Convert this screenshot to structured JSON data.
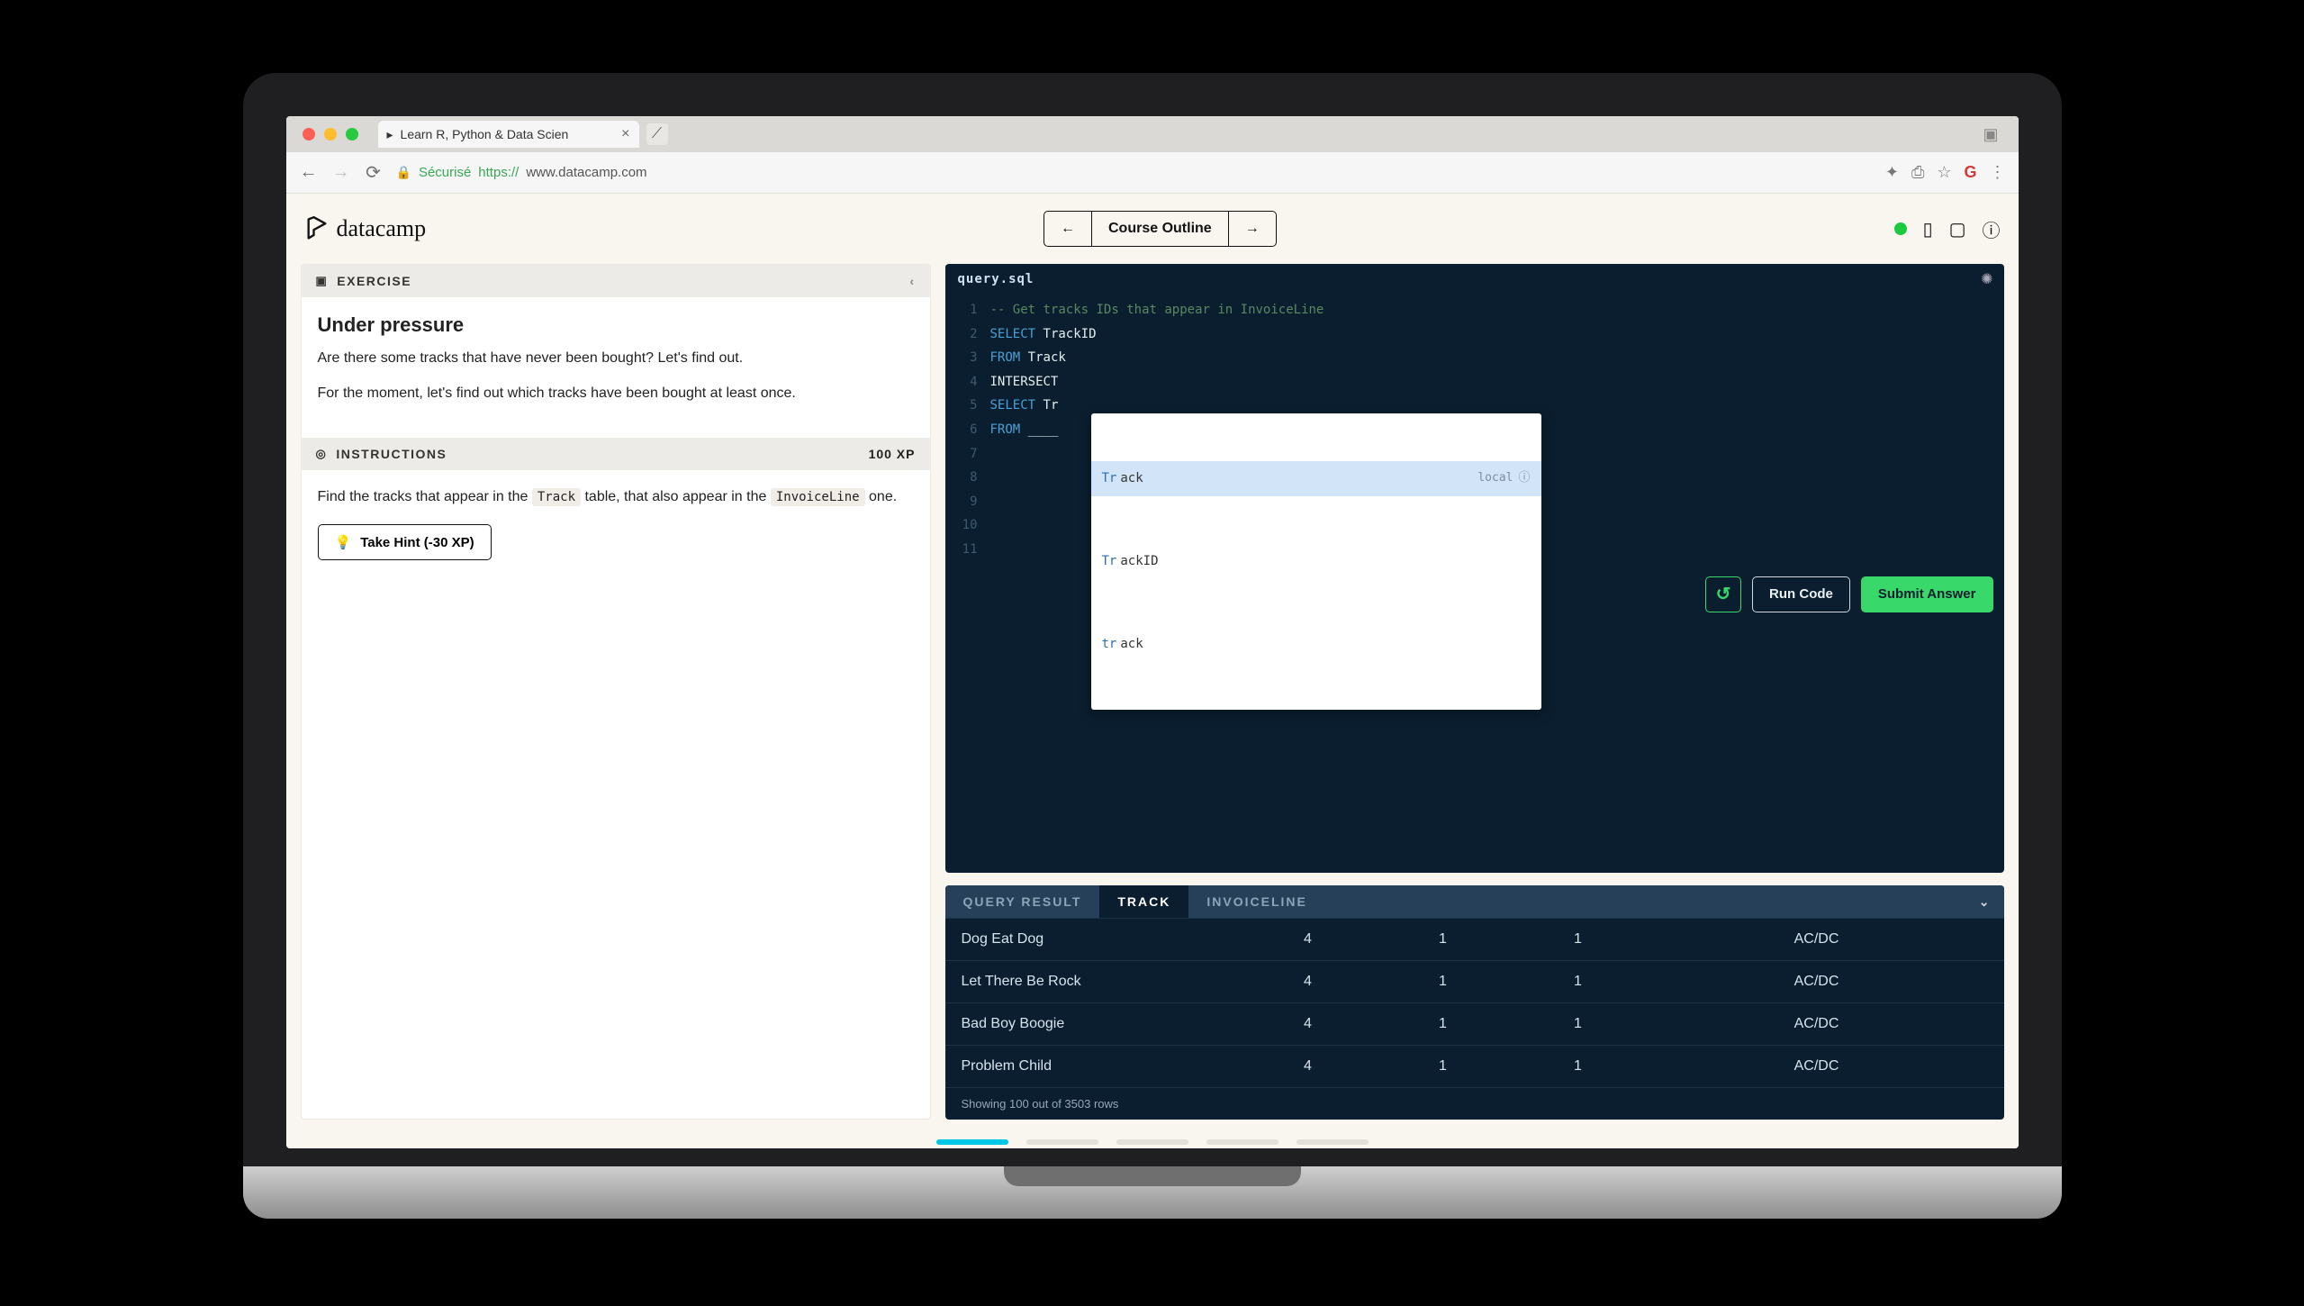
{
  "browser": {
    "tab_title": "Learn R, Python & Data Scien",
    "secure_label": "Sécurisé",
    "url_prefix": "https://",
    "url": "www.datacamp.com"
  },
  "header": {
    "brand": "datacamp",
    "course_outline_label": "Course Outline"
  },
  "exercise": {
    "section_label": "EXERCISE",
    "title": "Under pressure",
    "p1": "Are there some tracks that have never been bought? Let's find out.",
    "p2": "For the moment, let's find out which tracks have been bought at least once."
  },
  "instructions": {
    "section_label": "INSTRUCTIONS",
    "xp_label": "100 XP",
    "text_a": "Find the tracks that appear in the ",
    "code_a": "Track",
    "text_b": " table, that also appear in the ",
    "code_b": "InvoiceLine",
    "text_c": " one.",
    "hint_label": "Take Hint (-30 XP)"
  },
  "editor": {
    "tab_label": "query.sql",
    "lines": [
      "1",
      "2",
      "3",
      "4",
      "5",
      "6",
      "7",
      "8",
      "9",
      "10",
      "11"
    ],
    "code": {
      "l1_comment": "-- Get tracks IDs that appear in InvoiceLine",
      "l2_kw": "SELECT",
      "l2_id": "TrackID",
      "l3_kw": "FROM",
      "l3_id": "Track",
      "l4_id": "INTERSECT",
      "l5_kw": "SELECT",
      "l5_id": "Tr",
      "l6_kw": "FROM",
      "l6_id": "____"
    },
    "autocomplete": {
      "items": [
        {
          "match": "Tr",
          "rest": "ack"
        },
        {
          "match": "Tr",
          "rest": "ackID"
        },
        {
          "match": "tr",
          "rest": "ack"
        }
      ],
      "meta_label": "local"
    },
    "actions": {
      "run": "Run Code",
      "submit": "Submit Answer"
    }
  },
  "results": {
    "tabs": {
      "label": "query result",
      "track": "TRACK",
      "invoiceline": "INVOICELINE"
    },
    "rows": [
      {
        "c1": "Dog Eat Dog",
        "c2": "4",
        "c3": "1",
        "c4": "1",
        "c5": "AC/DC"
      },
      {
        "c1": "Let There Be Rock",
        "c2": "4",
        "c3": "1",
        "c4": "1",
        "c5": "AC/DC"
      },
      {
        "c1": "Bad Boy Boogie",
        "c2": "4",
        "c3": "1",
        "c4": "1",
        "c5": "AC/DC"
      },
      {
        "c1": "Problem Child",
        "c2": "4",
        "c3": "1",
        "c4": "1",
        "c5": "AC/DC"
      }
    ],
    "footer": "Showing 100 out of 3503 rows"
  },
  "chart_data": {
    "type": "table",
    "title": "TRACK",
    "rows": [
      {
        "Name": "Dog Eat Dog",
        "A": 4,
        "B": 1,
        "C": 1,
        "Artist": "AC/DC"
      },
      {
        "Name": "Let There Be Rock",
        "A": 4,
        "B": 1,
        "C": 1,
        "Artist": "AC/DC"
      },
      {
        "Name": "Bad Boy Boogie",
        "A": 4,
        "B": 1,
        "C": 1,
        "Artist": "AC/DC"
      },
      {
        "Name": "Problem Child",
        "A": 4,
        "B": 1,
        "C": 1,
        "Artist": "AC/DC"
      }
    ],
    "total_rows": 3503,
    "shown_rows": 100
  }
}
